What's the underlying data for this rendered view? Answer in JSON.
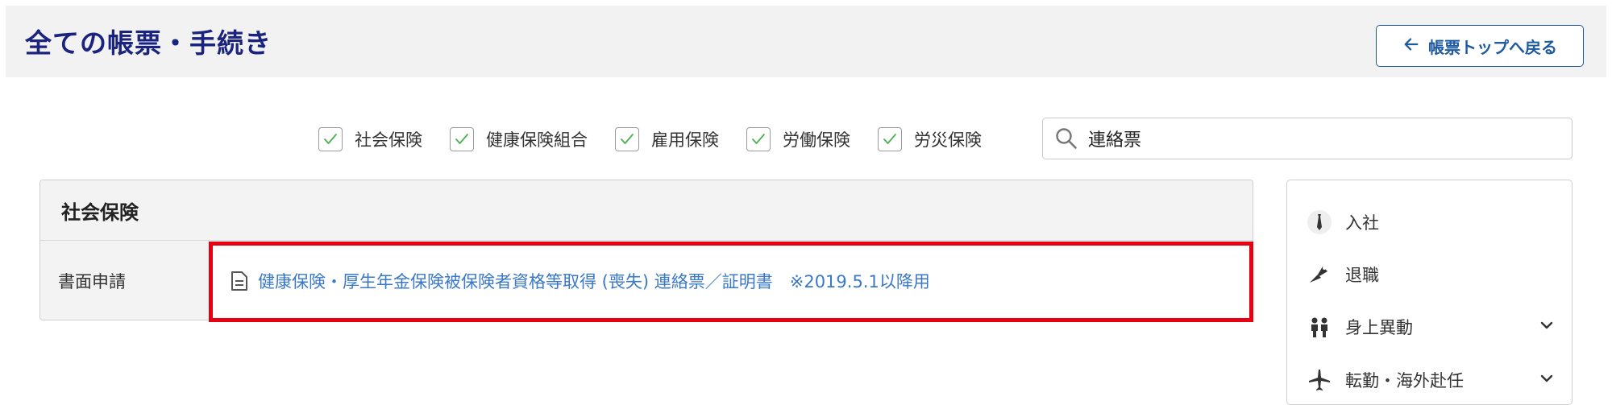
{
  "header": {
    "title": "全ての帳票・手続き",
    "back_label": "帳票トップへ戻る"
  },
  "filters": [
    {
      "label": "社会保険",
      "checked": true
    },
    {
      "label": "健康保険組合",
      "checked": true
    },
    {
      "label": "雇用保険",
      "checked": true
    },
    {
      "label": "労働保険",
      "checked": true
    },
    {
      "label": "労災保険",
      "checked": true
    }
  ],
  "search": {
    "value": "連絡票"
  },
  "panel": {
    "title": "社会保険",
    "row_label": "書面申請",
    "document_link": "健康保険・厚生年金保険被保険者資格等取得 (喪失) 連絡票／証明書　※2019.5.1以降用"
  },
  "side_menu": [
    {
      "label": "入社",
      "icon": "tie-icon",
      "expandable": false
    },
    {
      "label": "退職",
      "icon": "bouquet-icon",
      "expandable": false
    },
    {
      "label": "身上異動",
      "icon": "people-icon",
      "expandable": true
    },
    {
      "label": "転勤・海外赴任",
      "icon": "airplane-icon",
      "expandable": true
    }
  ],
  "colors": {
    "title": "#1a237e",
    "accent": "#1e5aa0",
    "link": "#3a78c9",
    "check": "#4caf50",
    "highlight": "#e60012"
  }
}
